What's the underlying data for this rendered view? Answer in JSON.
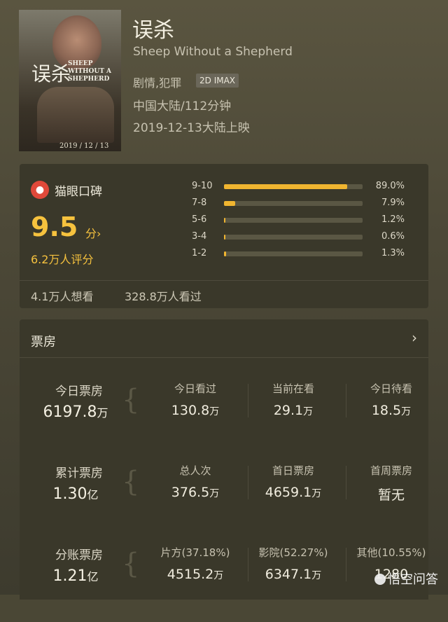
{
  "movie": {
    "title": "误杀",
    "subtitle": "Sheep Without a Shepherd",
    "genre": "剧情,犯罪",
    "format_badge": "2D IMAX",
    "region_duration": "中国大陆/112分钟",
    "release": "2019-12-13大陆上映",
    "poster": {
      "title_cn": "误杀",
      "title_en": "SHEEP WITHOUT A SHEPHERD",
      "date": "2019 / 12 / 13"
    }
  },
  "rating": {
    "brand": "猫眼口碑",
    "score": "9.5",
    "score_unit": "分›",
    "votes": "6.2万人评分",
    "distribution": [
      {
        "label": "9-10",
        "percent_text": "89.0%",
        "value": 89.0
      },
      {
        "label": "7-8",
        "percent_text": "7.9%",
        "value": 7.9
      },
      {
        "label": "5-6",
        "percent_text": "1.2%",
        "value": 1.2
      },
      {
        "label": "3-4",
        "percent_text": "0.6%",
        "value": 0.6
      },
      {
        "label": "1-2",
        "percent_text": "1.3%",
        "value": 1.3
      }
    ],
    "want_to_watch": "4.1万人想看",
    "watched": "328.8万人看过"
  },
  "box_office": {
    "title": "票房",
    "chevron": "›",
    "rows": [
      {
        "label": "今日票房",
        "value": "6197.8",
        "unit": "万",
        "cols": [
          {
            "header": "今日看过",
            "value": "130.8",
            "unit": "万"
          },
          {
            "header": "当前在看",
            "value": "29.1",
            "unit": "万"
          },
          {
            "header": "今日待看",
            "value": "18.5",
            "unit": "万"
          }
        ]
      },
      {
        "label": "累计票房",
        "value": "1.30",
        "unit": "亿",
        "cols": [
          {
            "header": "总人次",
            "value": "376.5",
            "unit": "万"
          },
          {
            "header": "首日票房",
            "value": "4659.1",
            "unit": "万"
          },
          {
            "header": "首周票房",
            "value": "暂无",
            "unit": ""
          }
        ]
      },
      {
        "label": "分账票房",
        "value": "1.21",
        "unit": "亿",
        "cols": [
          {
            "header": "片方(37.18%)",
            "value": "4515.2",
            "unit": "万"
          },
          {
            "header": "影院(52.27%)",
            "value": "6347.1",
            "unit": "万"
          },
          {
            "header": "其他(10.55%)",
            "value": "1280",
            "unit": ""
          }
        ]
      }
    ]
  },
  "watermark": "悟空问答",
  "colors": {
    "accent": "#f6c23e",
    "bar_fill": "#f0b530",
    "card_bg": "#3a382a"
  }
}
